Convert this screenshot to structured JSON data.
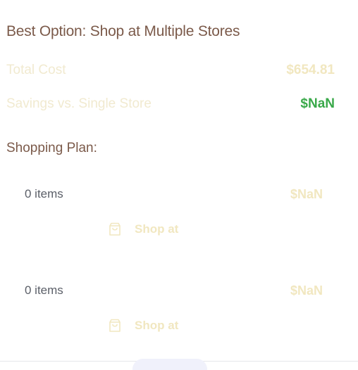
{
  "summary": {
    "title": "Best Option: Shop at Multiple Stores",
    "total_cost_label": "Total Cost",
    "total_cost_value": "$654.81",
    "savings_label": "Savings vs. Single Store",
    "savings_value": "$NaN"
  },
  "plan": {
    "heading": "Shopping Plan:",
    "stores": [
      {
        "items": "0 items",
        "subtotal": "$NaN",
        "button_label": "Shop at",
        "button_icon": "shopping-bag-icon"
      },
      {
        "items": "0 items",
        "subtotal": "$NaN",
        "button_label": "Shop at",
        "button_icon": "shopping-bag-icon"
      }
    ]
  },
  "colors": {
    "title": "#7b5a4a",
    "muted_value": "#f1e7c0",
    "savings": "#3aa94a",
    "items_text": "#5b5f68"
  }
}
